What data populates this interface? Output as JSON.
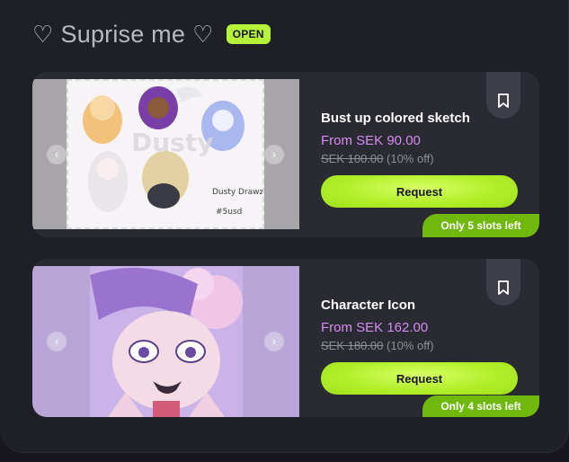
{
  "header": {
    "title": "Suprise me",
    "heart_glyph": "♡",
    "status_badge": "OPEN"
  },
  "colors": {
    "accent": "#b6f23a",
    "price": "#d58cf0",
    "slots_bg": "#6fb80c",
    "card_bg": "#2a2a33"
  },
  "cards": [
    {
      "name": "Bust up colored sketch",
      "price": "From SEK 90.00",
      "old_price": "SEK 100.00",
      "discount": "(10% off)",
      "request_label": "Request",
      "slots": "Only 5 slots left",
      "image_caption": "Dusty Drawzzz",
      "image_signature": "#5usd"
    },
    {
      "name": "Character Icon",
      "price": "From SEK 162.00",
      "old_price": "SEK 180.00",
      "discount": "(10% off)",
      "request_label": "Request",
      "slots": "Only 4 slots left"
    }
  ],
  "icons": {
    "prev": "chevron-left-icon",
    "next": "chevron-right-icon",
    "bookmark": "bookmark-icon"
  }
}
